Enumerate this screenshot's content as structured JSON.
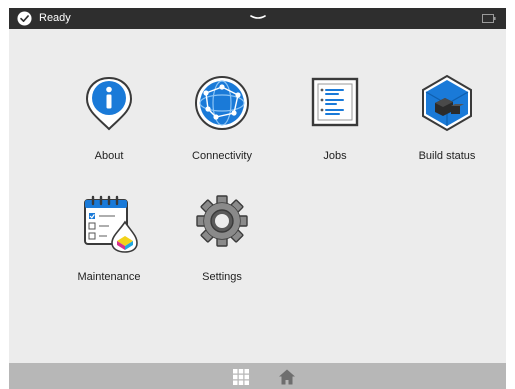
{
  "status_bar": {
    "status_text": "Ready",
    "icons": [
      "checkmark-circle-icon",
      "pull-down-handle-icon",
      "battery-icon"
    ]
  },
  "apps": [
    {
      "label": "About",
      "icon": "info-pin-icon"
    },
    {
      "label": "Connectivity",
      "icon": "network-globe-icon"
    },
    {
      "label": "Jobs",
      "icon": "job-list-icon"
    },
    {
      "label": "Build status",
      "icon": "build-cube-icon"
    },
    {
      "label": "Maintenance",
      "icon": "maintenance-calendar-icon"
    },
    {
      "label": "Settings",
      "icon": "gear-icon"
    }
  ],
  "bottom_nav": {
    "items": [
      "apps-grid-icon",
      "home-icon"
    ],
    "active": "apps-grid-icon"
  },
  "colors": {
    "status_bar": "#2e2e2e",
    "background": "#ececec",
    "bottom_bar": "#b7b7b7",
    "accent_blue": "#1a7ad8"
  }
}
